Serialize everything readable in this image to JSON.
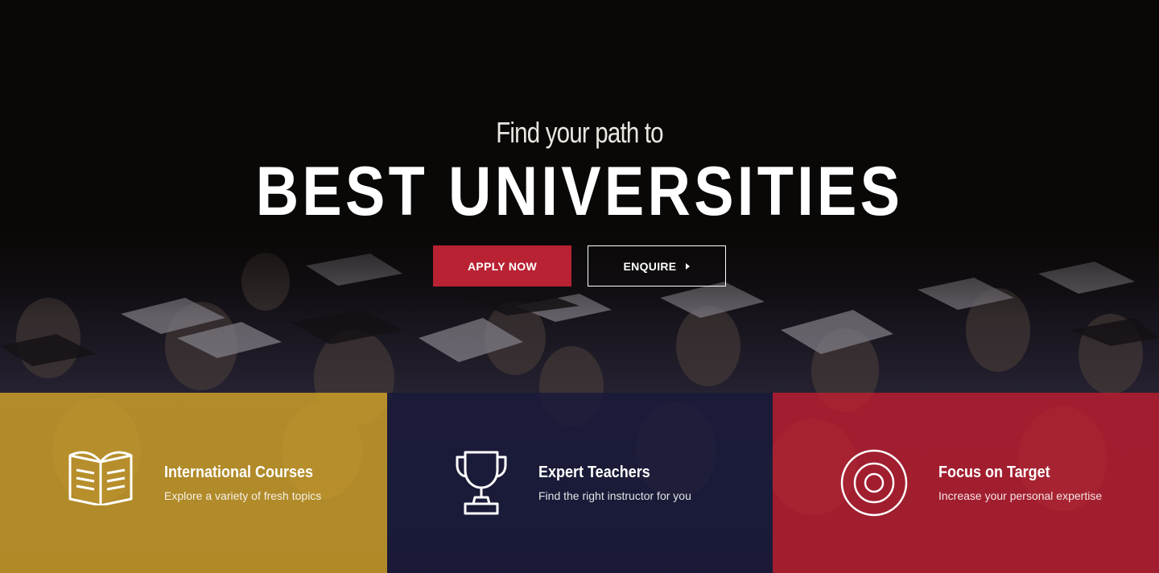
{
  "hero": {
    "subtitle": "Find your path to",
    "title": "BEST UNIVERSITIES",
    "apply_label": "APPLY NOW",
    "enquire_label": "ENQUIRE"
  },
  "features": [
    {
      "icon": "open-book-icon",
      "title": "International Courses",
      "description": "Explore a variety of fresh topics",
      "color": "#d4a528"
    },
    {
      "icon": "trophy-icon",
      "title": "Expert Teachers",
      "description": "Find the right instructor for you",
      "color": "#181a3a"
    },
    {
      "icon": "target-icon",
      "title": "Focus on Target",
      "description": "Increase your personal expertise",
      "color": "#c41e30"
    }
  ],
  "colors": {
    "accent": "#b82233",
    "background": "#0a0806"
  }
}
